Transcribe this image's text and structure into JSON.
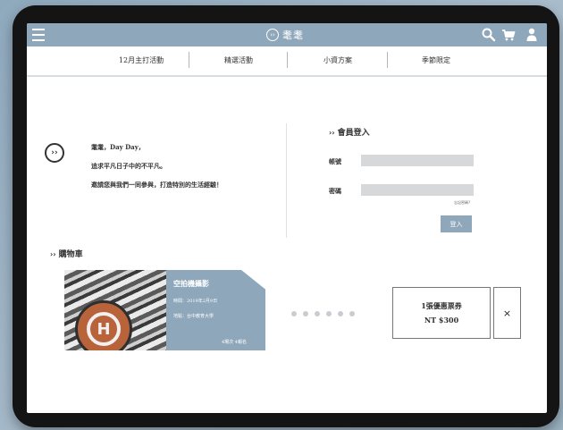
{
  "header": {
    "brand_logo_text": "››",
    "brand_name": "耄耄",
    "icons": [
      "menu-icon",
      "search-icon",
      "cart-icon",
      "user-icon"
    ]
  },
  "nav": {
    "tabs": [
      {
        "label": "12月主打活動"
      },
      {
        "label": "精選活動"
      },
      {
        "label": "小資方案"
      },
      {
        "label": "季節限定"
      }
    ]
  },
  "intro": {
    "logo_text": "››",
    "lines": [
      "耄耄，Day Day，",
      "追求平凡日子中的不平凡。",
      "邀請您與我們一同參與，打造特別的生活經驗！"
    ]
  },
  "login": {
    "title_mark": "››",
    "title": "會員登入",
    "account_label": "帳號",
    "account_value": "",
    "password_label": "密碼",
    "password_value": "",
    "forgot_label": "忘記密碼?",
    "submit_label": "登入"
  },
  "cart": {
    "title_mark": "››",
    "title": "購物車",
    "item": {
      "name": "空拍機攝影",
      "time": "時間：2019年2月9日",
      "place": "地點：台中教育大學",
      "meta": "4場次  4報名"
    },
    "carousel_dots": 6
  },
  "coupon": {
    "line1": "1張優惠票券",
    "price": "NT $300",
    "close_label": "×"
  },
  "colors": {
    "accent": "#8ea7ba",
    "input_bg": "#d6d8da"
  }
}
